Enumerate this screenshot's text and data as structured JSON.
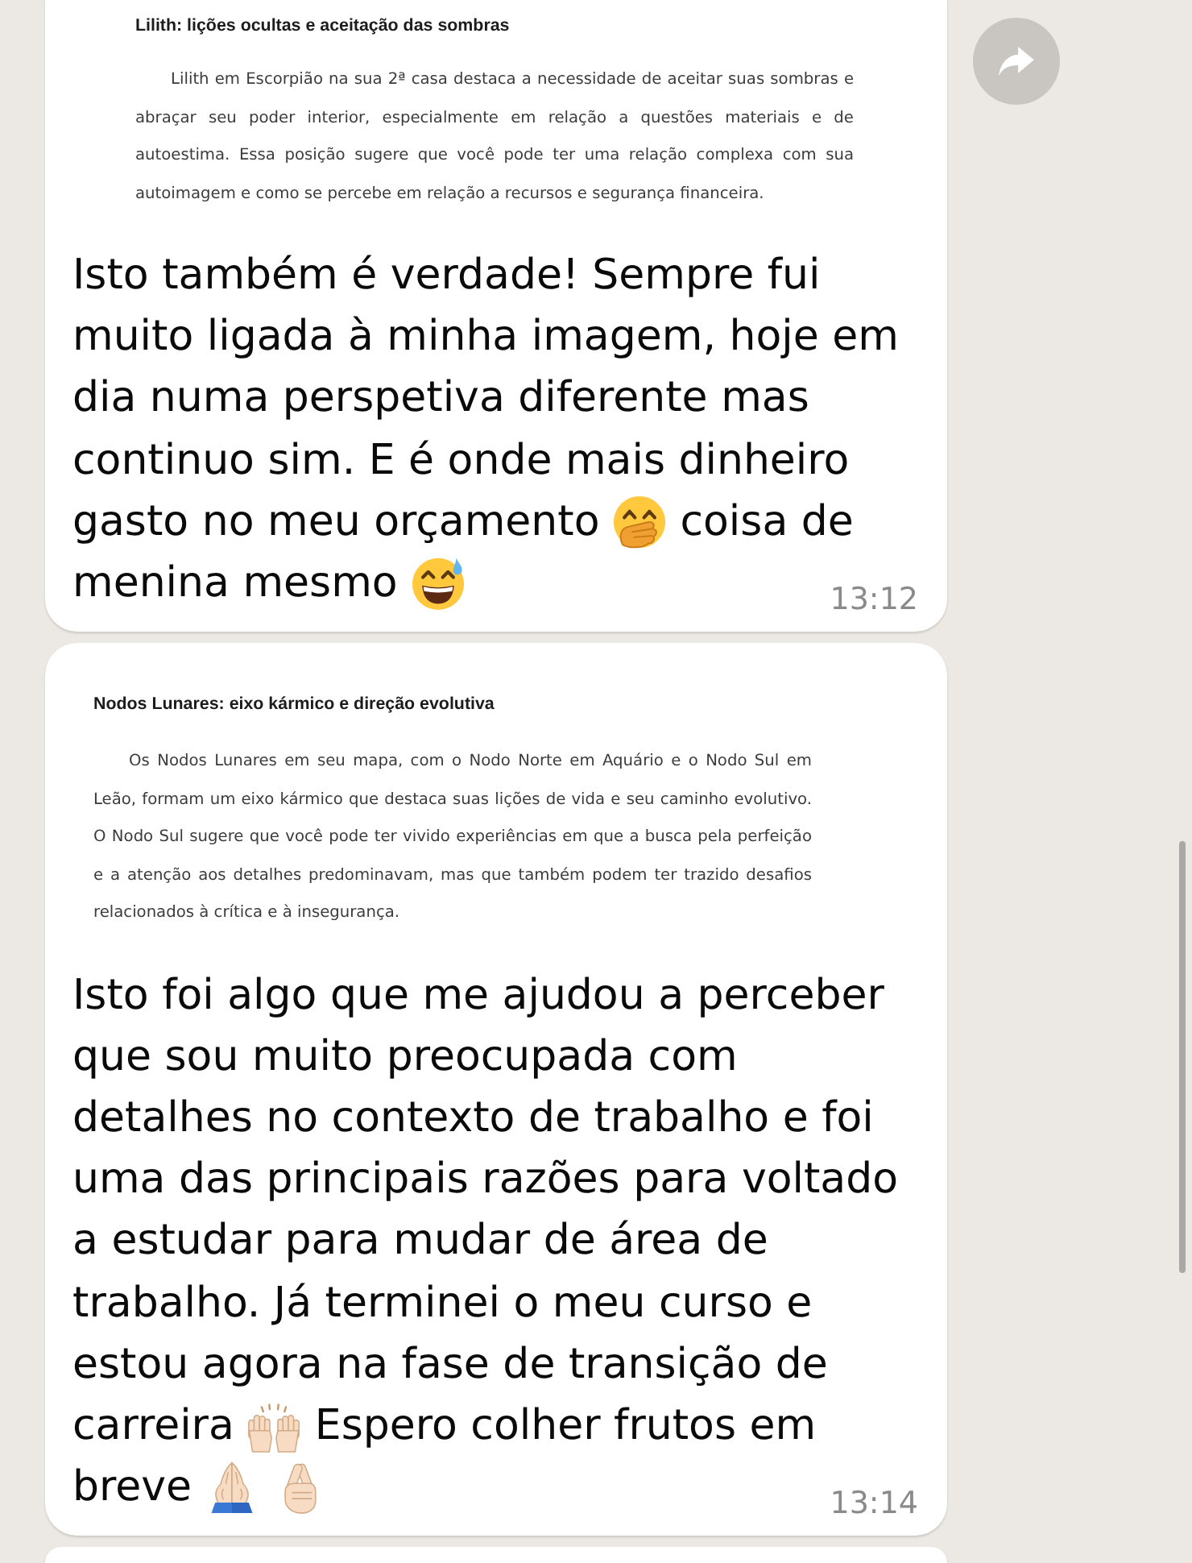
{
  "messages": [
    {
      "partial": false,
      "forward": true,
      "document": {
        "heading": "Lilith: lições ocultas e aceitação das sombras",
        "paragraph": "Lilith em Escorpião na sua 2ª casa destaca a necessidade de aceitar suas sombras e abraçar seu poder interior, especialmente em relação a questões materiais e de autoestima. Essa posição sugere que você pode ter uma relação complexa com sua autoimagem e como se percebe em relação a recursos e segurança financeira."
      },
      "caption": [
        [
          {
            "kind": "text",
            "text": "Isto também é verdade! Sempre fui"
          }
        ],
        [
          {
            "kind": "text",
            "text": "muito ligada à minha imagem, hoje em"
          }
        ],
        [
          {
            "kind": "text",
            "text": "dia numa perspetiva diferente mas"
          }
        ],
        [
          {
            "kind": "text",
            "text": "continuo sim. E é onde mais dinheiro"
          }
        ],
        [
          {
            "kind": "text",
            "text": "gasto no meu orçamento"
          },
          {
            "kind": "giggle"
          },
          {
            "kind": "text",
            "text": "coisa de"
          }
        ],
        [
          {
            "kind": "text",
            "text": "menina mesmo"
          },
          {
            "kind": "sweat"
          }
        ]
      ],
      "time": "13:12"
    },
    {
      "partial": false,
      "forward": false,
      "document": {
        "heading": "Nodos Lunares: eixo kármico e direção evolutiva",
        "paragraph": "Os Nodos Lunares em seu mapa, com o Nodo Norte em Aquário e o Nodo Sul em Leão, formam um eixo kármico que destaca suas lições de vida e seu caminho evolutivo. O Nodo Sul sugere que você pode ter vivido experiências em que a busca pela perfeição e a atenção aos detalhes predominavam, mas que também podem ter trazido desafios relacionados à crítica e à insegurança."
      },
      "caption": [
        [
          {
            "kind": "text",
            "text": "Isto foi algo que me ajudou a perceber"
          }
        ],
        [
          {
            "kind": "text",
            "text": "que sou muito preocupada com"
          }
        ],
        [
          {
            "kind": "text",
            "text": "detalhes no contexto de trabalho e foi"
          }
        ],
        [
          {
            "kind": "text",
            "text": "uma das principais razões para voltado"
          }
        ],
        [
          {
            "kind": "text",
            "text": "a estudar para mudar de área de"
          }
        ],
        [
          {
            "kind": "text",
            "text": "trabalho. Já terminei o meu curso e"
          }
        ],
        [
          {
            "kind": "text",
            "text": "estou agora na fase de transição de"
          }
        ],
        [
          {
            "kind": "text",
            "text": "carreira"
          },
          {
            "kind": "cheer"
          },
          {
            "kind": "text",
            "text": "Espero colher frutos em"
          }
        ],
        [
          {
            "kind": "text",
            "text": "breve"
          },
          {
            "kind": "pray"
          },
          {
            "kind": "crossed"
          }
        ]
      ],
      "time": "13:14"
    },
    {
      "partial": true,
      "forward": false
    }
  ],
  "scroll_indicator": true
}
